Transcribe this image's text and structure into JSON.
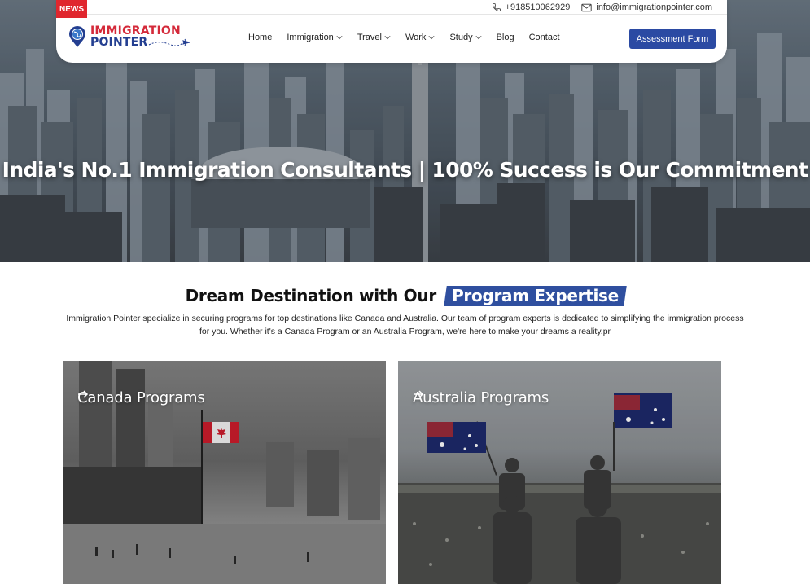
{
  "news_tag": "NEWS",
  "topbar": {
    "phone": "+918510062929",
    "email": "info@immigrationpointer.com"
  },
  "logo": {
    "line1": "IMMIGRATION",
    "line2": "POINTER"
  },
  "nav": {
    "items": [
      {
        "label": "Home",
        "dropdown": false
      },
      {
        "label": "Immigration",
        "dropdown": true
      },
      {
        "label": "Travel",
        "dropdown": true
      },
      {
        "label": "Work",
        "dropdown": true
      },
      {
        "label": "Study",
        "dropdown": true
      },
      {
        "label": "Blog",
        "dropdown": false
      },
      {
        "label": "Contact",
        "dropdown": false
      }
    ]
  },
  "assessment_button": "Assessment Form",
  "hero": {
    "title": "India's No.1 Immigration Consultants | 100% Success is Our Commitment"
  },
  "section": {
    "title_prefix": "Dream Destination with Our",
    "title_highlight": "Program Expertise",
    "description": "Immigration Pointer specialize in securing programs for top destinations like Canada and Australia. Our team of program experts is dedicated to simplifying the immigration process for you. Whether it's a Canada Program or an Australia Program, we're here to make your dreams a reality.pr"
  },
  "cards": [
    {
      "label": "Canada Programs"
    },
    {
      "label": "Australia Programs"
    }
  ],
  "colors": {
    "brand_blue": "#2b4aa3",
    "brand_red": "#d42a3a",
    "news_red": "#e0262e",
    "highlight_blue": "#2f4f9f"
  }
}
